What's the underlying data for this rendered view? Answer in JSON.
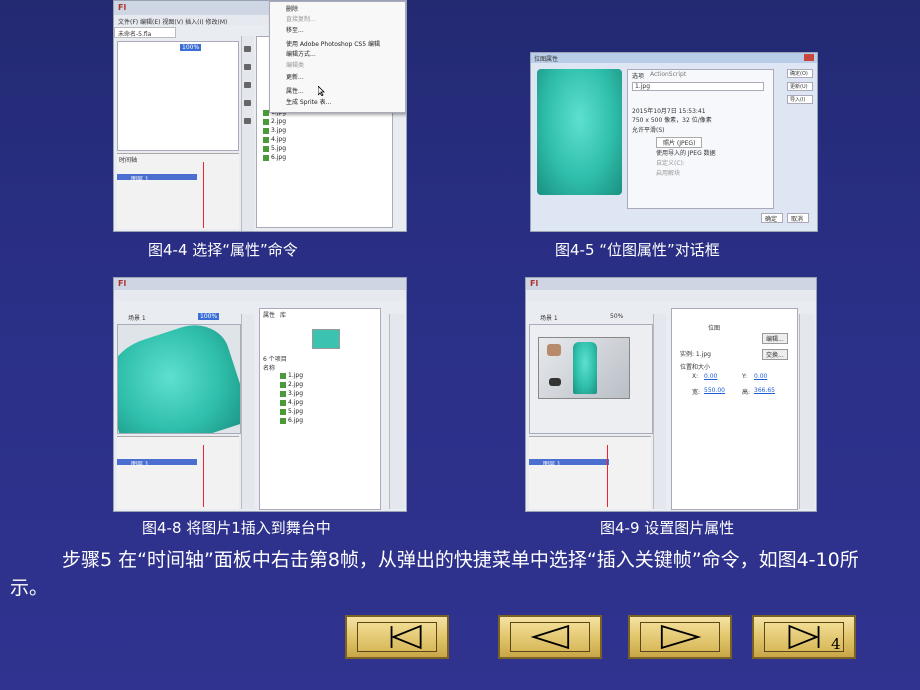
{
  "figures": [
    {
      "caption": "图4-4  选择“属性”命令",
      "app": "Fl",
      "menu_items": [
        "删除",
        "直接复制...",
        "移至...",
        "使用 Adobe Photoshop CS5 编辑",
        "编辑方式...",
        "编辑类",
        "更新...",
        "属性...",
        "生成 Sprite 表..."
      ],
      "files": [
        "1.jpg",
        "2.jpg",
        "3.jpg",
        "4.jpg",
        "5.jpg",
        "6.jpg"
      ],
      "zoom": "100%",
      "layer": "图层 1",
      "timeline_tab": "时间轴",
      "tab": "未命名-5.fla"
    },
    {
      "caption": "图4-5  “位图属性”对话框",
      "dialog_title": "位图属性",
      "tabs": [
        "选项",
        "ActionScript"
      ],
      "filename": "1.jpg",
      "buttons": [
        "确定(O)",
        "更新(U)",
        "导入(I)",
        "测试(T)"
      ],
      "bottom_buttons": [
        "确定",
        "取消"
      ],
      "info_lines": [
        "2015年10月7日 15:53:41",
        "750 x 500 像素，32 位/像素",
        "允许平滑(S)"
      ],
      "compression": "照片 (JPEG)",
      "quality_opts": [
        "使用导入的 JPEG 数据",
        "自定义(C):",
        "启用解块"
      ]
    },
    {
      "caption": "图4-8  将图片1插入到舞台中",
      "app": "Fl",
      "zoom": "100%",
      "scene": "场景 1",
      "files": [
        "1.jpg",
        "2.jpg",
        "3.jpg",
        "4.jpg",
        "5.jpg",
        "6.jpg"
      ],
      "panel_tabs": [
        "属性",
        "库"
      ],
      "items_count": "6 个项目",
      "name_header": "名称",
      "layer": "图层 1"
    },
    {
      "caption": "图4-9  设置图片属性",
      "app": "Fl",
      "zoom": "50%",
      "scene": "场景 1",
      "prop_title": "位图",
      "instance": "实例: 1.jpg",
      "section": "位置和大小",
      "x_label": "X:",
      "x_val": "0.00",
      "y_label": "Y:",
      "y_val": "0.00",
      "w_label": "宽:",
      "w_val": "550.00",
      "h_label": "高:",
      "h_val": "366.65",
      "edit_btn": "编辑...",
      "swap_btn": "交换...",
      "layer": "图层 1"
    }
  ],
  "paragraph": "步骤5  在“时间轴”面板中右击第8帧，从弹出的快捷菜单中选择“插入关键帧”命令，如图4-10所示。",
  "page_number": "4",
  "nav": [
    {
      "name": "first-slide-button",
      "icon": "first-icon"
    },
    {
      "name": "previous-slide-button",
      "icon": "previous-icon"
    },
    {
      "name": "next-slide-button",
      "icon": "next-icon"
    },
    {
      "name": "last-slide-button",
      "icon": "last-icon"
    }
  ],
  "colors": {
    "background": "#2a2f86",
    "button": "#e2c66b",
    "coat": "#2fbfab"
  }
}
